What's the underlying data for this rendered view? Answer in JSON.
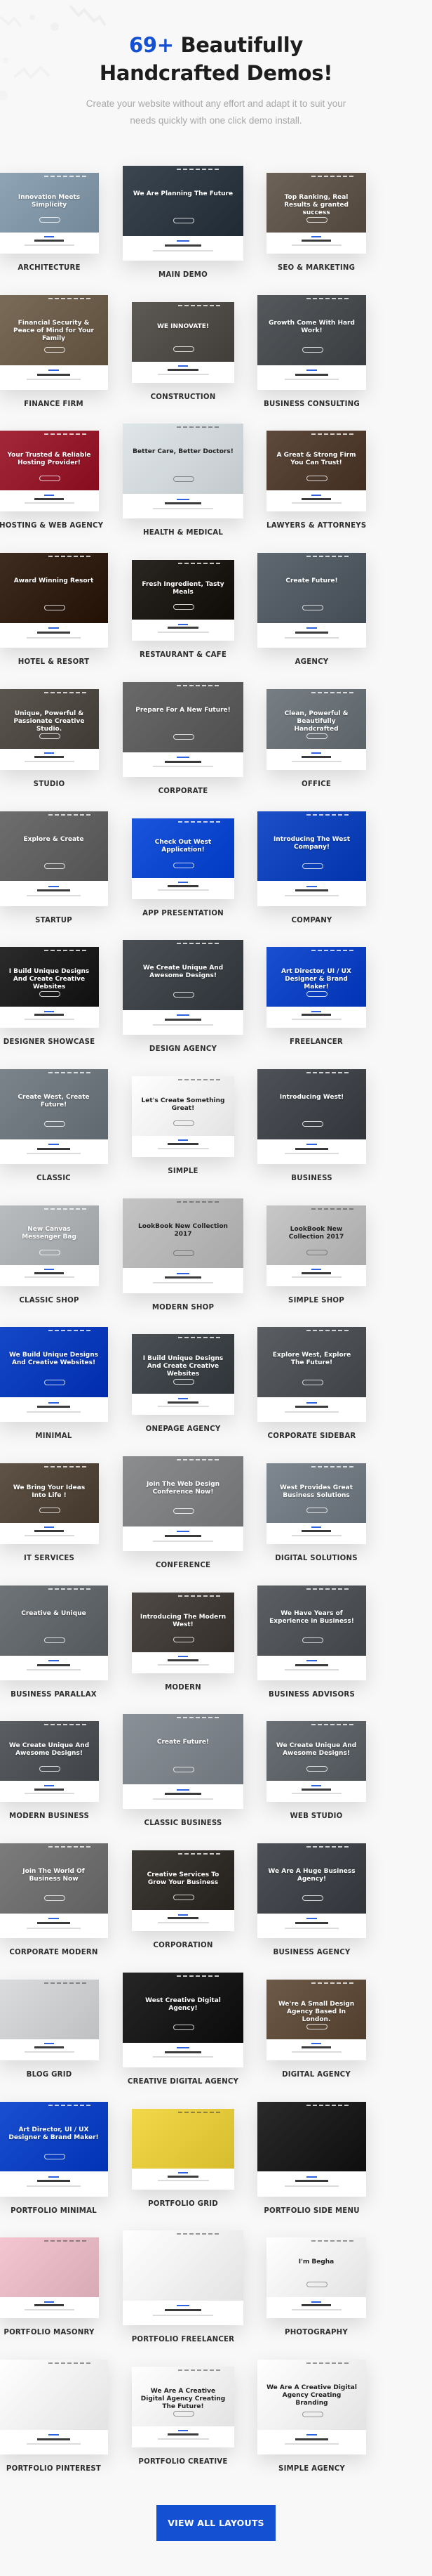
{
  "header": {
    "title_accent": "69+",
    "title_line1_rest": " Beautifully",
    "title_line2": "Handcrafted Demos!",
    "subtitle": "Create your website without any effort and adapt it to suit your needs quickly with one click demo install."
  },
  "colors": {
    "accent": "#1450d2",
    "background": "#f8f8f8",
    "label": "#2e2e2e",
    "subtitle": "#a8a8a8"
  },
  "demos": [
    {
      "label": "ARCHITECTURE",
      "headline": "Innovation Meets Simplicity",
      "theme": "#8fa4b5"
    },
    {
      "label": "MAIN DEMO",
      "headline": "We Are Planning The Future",
      "theme": "#3c4650"
    },
    {
      "label": "SEO & MARKETING",
      "headline": "Top Ranking, Real Results & granted success",
      "theme": "#6c6258"
    },
    {
      "label": "FINANCE FIRM",
      "headline": "Financial Security & Peace of Mind for Your Family",
      "theme": "#7a6a58"
    },
    {
      "label": "CONSTRUCTION",
      "headline": "WE INNOVATE!",
      "theme": "#5d5a55"
    },
    {
      "label": "BUSINESS CONSULTING",
      "headline": "Growth Come With Hard Work!",
      "theme": "#55595c"
    },
    {
      "label": "HOSTING & WEB AGENCY",
      "headline": "Your Trusted & Reliable Hosting Provider!",
      "theme": "#a3283a"
    },
    {
      "label": "HEALTH & MEDICAL",
      "headline": "Better Care, Better Doctors!",
      "theme": "#dfe6ea"
    },
    {
      "label": "LAWYERS & ATTORNEYS",
      "headline": "A Great & Strong Firm You Can Trust!",
      "theme": "#5e4a3c"
    },
    {
      "label": "HOTEL & RESORT",
      "headline": "Award Winning Resort",
      "theme": "#3e2c20"
    },
    {
      "label": "RESTAURANT & CAFE",
      "headline": "Fresh Ingredient, Tasty Meals",
      "theme": "#2a2622"
    },
    {
      "label": "AGENCY",
      "headline": "Create Future!",
      "theme": "#5f6870"
    },
    {
      "label": "STUDIO",
      "headline": "Unique, Powerful & Passionate Creative Studio.",
      "theme": "#5b5650"
    },
    {
      "label": "CORPORATE",
      "headline": "Prepare For A New Future!",
      "theme": "#6a6a6a"
    },
    {
      "label": "OFFICE",
      "headline": "Clean, Powerful & Beautifully Handcrafted",
      "theme": "#777f84"
    },
    {
      "label": "STARTUP",
      "headline": "Explore & Create",
      "theme": "#6e6e6e"
    },
    {
      "label": "APP PRESENTATION",
      "headline": "Check Out West Application!",
      "theme": "#1a55de"
    },
    {
      "label": "COMPANY",
      "headline": "Introducing The West Company!",
      "theme": "#1c4fc8"
    },
    {
      "label": "DESIGNER SHOWCASE",
      "headline": "I Build Unique Designs And Create Creative Websites",
      "theme": "#2b2b2b"
    },
    {
      "label": "DESIGN AGENCY",
      "headline": "We Create Unique And Awesome Designs!",
      "theme": "#4a4f54"
    },
    {
      "label": "FREELANCER",
      "headline": "Art Director, UI / UX Designer & Brand Maker!",
      "theme": "#1a4fd0"
    },
    {
      "label": "CLASSIC",
      "headline": "Create West, Create Future!",
      "theme": "#7b848b"
    },
    {
      "label": "SIMPLE",
      "headline": "Let's Create Something Great!",
      "theme": "#ffffff"
    },
    {
      "label": "BUSINESS",
      "headline": "Introducing West!",
      "theme": "#4e5257"
    },
    {
      "label": "CLASSIC SHOP",
      "headline": "New Canvas Messenger Bag",
      "theme": "#b9bcbf"
    },
    {
      "label": "MODERN SHOP",
      "headline": "LookBook New Collection 2017",
      "theme": "#c4c4c4"
    },
    {
      "label": "SIMPLE SHOP",
      "headline": "LookBook New Collection 2017",
      "theme": "#c7c7c7"
    },
    {
      "label": "MINIMAL",
      "headline": "We Build Unique Designs And Creative Websites!",
      "theme": "#1448c8"
    },
    {
      "label": "ONEPAGE AGENCY",
      "headline": "I Build Unique Designs And Create Creative Websites",
      "theme": "#4b5055"
    },
    {
      "label": "CORPORATE SIDEBAR",
      "headline": "Explore West, Explore The Future!",
      "theme": "#5a5e62"
    },
    {
      "label": "IT SERVICES",
      "headline": "We Bring Your Ideas Into Life !",
      "theme": "#5f5347"
    },
    {
      "label": "CONFERENCE",
      "headline": "Join The Web Design Conference Now!",
      "theme": "#8b8d8f"
    },
    {
      "label": "DIGITAL SOLUTIONS",
      "headline": "West Provides Great Business Solutions",
      "theme": "#7f8890"
    },
    {
      "label": "BUSINESS PARALLAX",
      "headline": "Creative & Unique",
      "theme": "#6f7478"
    },
    {
      "label": "MODERN",
      "headline": "Introducing The Modern West!",
      "theme": "#4f4a46"
    },
    {
      "label": "BUSINESS ADVISORS",
      "headline": "We Have Years of Experience in Business!",
      "theme": "#5c6064"
    },
    {
      "label": "MODERN BUSINESS",
      "headline": "We Create Unique And Awesome Designs!",
      "theme": "#5b5e62"
    },
    {
      "label": "CLASSIC BUSINESS",
      "headline": "Create Future!",
      "theme": "#8a9198"
    },
    {
      "label": "WEB STUDIO",
      "headline": "We Create Unique And Awesome Designs!",
      "theme": "#6b7075"
    },
    {
      "label": "CORPORATE MODERN",
      "headline": "Join The World Of Business Now",
      "theme": "#7c7c7c"
    },
    {
      "label": "CORPORATION",
      "headline": "Creative Services To Grow Your Business",
      "theme": "#3f3b36"
    },
    {
      "label": "BUSINESS AGENCY",
      "headline": "We Are A Huge Business Agency!",
      "theme": "#4d5156"
    },
    {
      "label": "BLOG GRID",
      "headline": "",
      "theme": "#dadcdd"
    },
    {
      "label": "CREATIVE DIGITAL AGENCY",
      "headline": "West Creative Digital Agency!",
      "theme": "#262626"
    },
    {
      "label": "DIGITAL AGENCY",
      "headline": "We're A Small Design Agency Based In London.",
      "theme": "#6d5a48"
    },
    {
      "label": "PORTFOLIO MINIMAL",
      "headline": "Art Director, UI / UX Designer & Brand Maker!",
      "theme": "#1a4fd0"
    },
    {
      "label": "PORTFOLIO GRID",
      "headline": "",
      "theme": "#f2d94a"
    },
    {
      "label": "PORTFOLIO SIDE MENU",
      "headline": "",
      "theme": "#2a2a2a"
    },
    {
      "label": "PORTFOLIO MASONRY",
      "headline": "",
      "theme": "#f3c6d2"
    },
    {
      "label": "PORTFOLIO FREELANCER",
      "headline": "",
      "theme": "#ffffff"
    },
    {
      "label": "PHOTOGRAPHY",
      "headline": "I'm Begha",
      "theme": "#ffffff"
    },
    {
      "label": "PORTFOLIO PINTEREST",
      "headline": "",
      "theme": "#ffffff"
    },
    {
      "label": "PORTFOLIO CREATIVE",
      "headline": "We Are A Creative Digital Agency Creating The Future!",
      "theme": "#ffffff"
    },
    {
      "label": "SIMPLE AGENCY",
      "headline": "We Are A Creative Digital Agency Creating Branding",
      "theme": "#ffffff"
    }
  ],
  "cta": {
    "view_all_label": "VIEW ALL LAYOUTS"
  }
}
